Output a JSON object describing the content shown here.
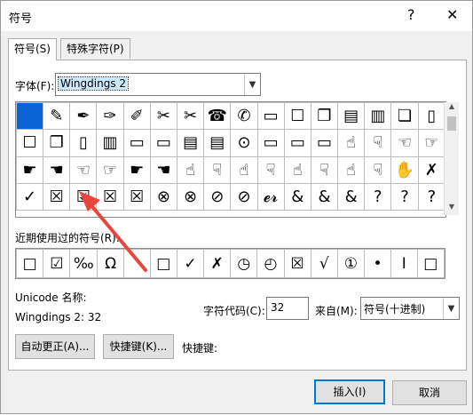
{
  "dialog": {
    "title": "符号",
    "help_glyph": "?",
    "close_glyph": "✕"
  },
  "tabs": [
    {
      "label": "符号(S)",
      "active": true
    },
    {
      "label": "特殊字符(P)",
      "active": false
    }
  ],
  "font": {
    "label": "字体(F):",
    "value": "Wingdings 2"
  },
  "symbol_grid": {
    "selected_index": 0,
    "rows": [
      [
        "",
        "✎",
        "✒",
        "✑",
        "✐",
        "✂",
        "✂",
        "☎",
        "✆",
        "▭",
        "☐",
        "❐",
        "▤",
        "▥",
        "❏",
        "▯"
      ],
      [
        "☐",
        "❐",
        "▯",
        "▥",
        "▭",
        "▭",
        "▤",
        "▤",
        "⊙",
        "▭",
        "▭",
        "▭",
        "☝",
        "☟",
        "☜",
        "☞"
      ],
      [
        "☛",
        "☚",
        "☜",
        "☞",
        "☛",
        "☚",
        "☝",
        "☟",
        "☝",
        "☟",
        "☝",
        "☟",
        "☝",
        "☟",
        "✋",
        "✗"
      ],
      [
        "✓",
        "☒",
        "☑",
        "☒",
        "☒",
        "⊗",
        "⊗",
        "⊘",
        "⊘",
        "𝓮𝓻",
        "&",
        "&",
        "&",
        "?",
        "?",
        "?"
      ]
    ]
  },
  "recent": {
    "label": "近期使用过的符号(R):",
    "items": [
      "□",
      "☑",
      "‰",
      "Ω",
      "",
      "□",
      "✓",
      "✗",
      "◷",
      "◴",
      "☒",
      "√",
      "①",
      "•",
      "I",
      "□"
    ]
  },
  "unicode_name": {
    "label": "Unicode 名称:",
    "value": "Wingdings 2: 32"
  },
  "char_code": {
    "label": "字符代码(C):",
    "value": "32"
  },
  "from": {
    "label": "来自(M):",
    "value": "符号(十进制)"
  },
  "buttons": {
    "autocorrect": "自动更正(A)...",
    "shortcut_key": "快捷键(K)...",
    "shortcut_label": "快捷键:",
    "insert": "插入(I)",
    "cancel": "取消"
  },
  "colors": {
    "selection": "#0a64d6",
    "annotation_arrow": "#e8463c",
    "default_button_border": "#0078d7"
  }
}
